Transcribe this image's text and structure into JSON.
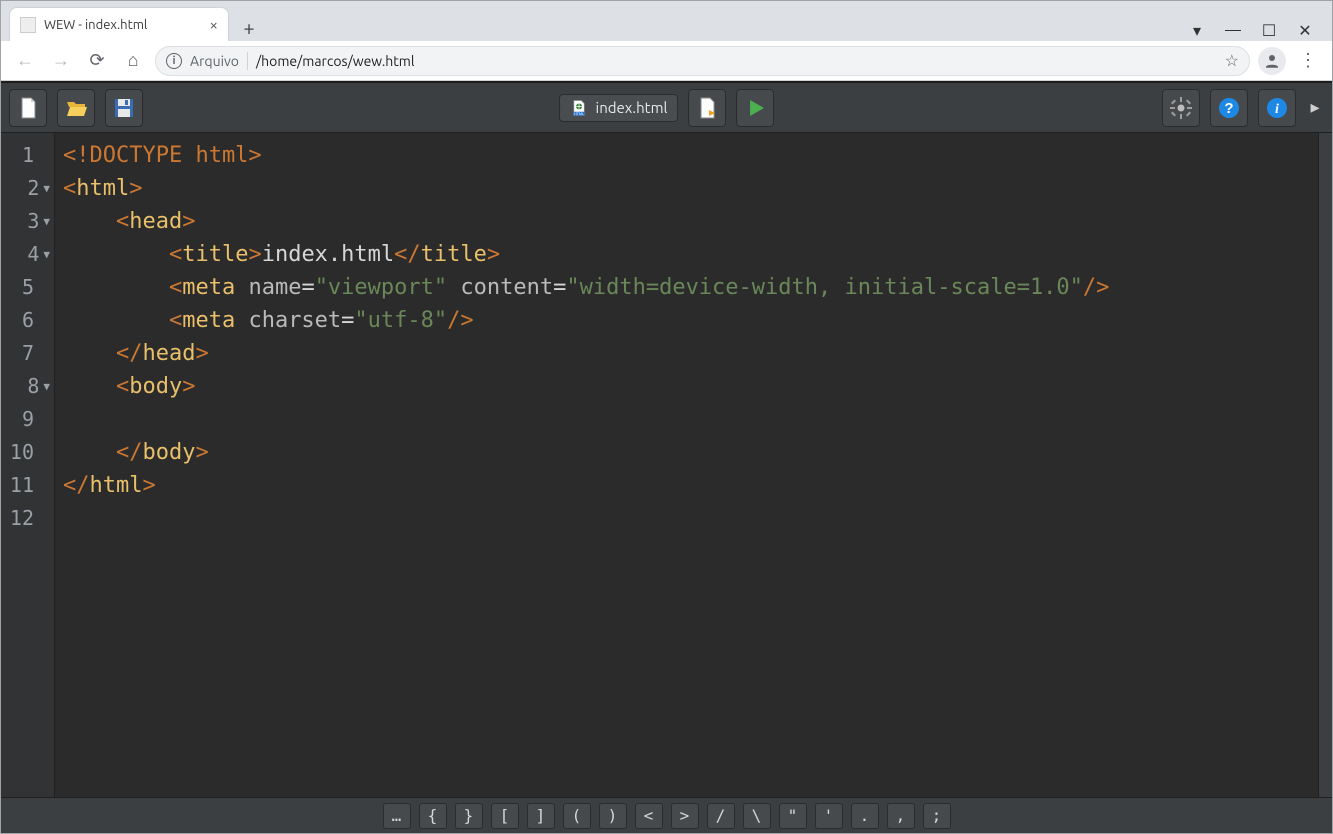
{
  "window": {
    "tab_title": "WEW - index.html",
    "minimize_glyph": "—",
    "maximize_glyph": "☐",
    "close_glyph": "✕"
  },
  "browser": {
    "tab_close_glyph": "×",
    "newtab_glyph": "+",
    "arrow_down_glyph": "▾",
    "info_glyph": "i",
    "file_label": "Arquivo",
    "path": "/home/marcos/wew.html",
    "star_glyph": "☆",
    "kebab_glyph": "⋮"
  },
  "editor": {
    "file_tab_label": "index.html",
    "more_glyph": "▸",
    "gutter": {
      "lines": [
        "1",
        "2",
        "3",
        "4",
        "5",
        "6",
        "7",
        "8",
        "9",
        "10",
        "11",
        "12"
      ],
      "fold_rows": [
        2,
        3,
        4,
        8
      ]
    },
    "code_lines": [
      {
        "indent": 0,
        "type": "decl",
        "text": "<!DOCTYPE html>"
      },
      {
        "indent": 0,
        "type": "open",
        "tag": "html"
      },
      {
        "indent": 1,
        "type": "open",
        "tag": "head"
      },
      {
        "indent": 2,
        "type": "wrap",
        "tag": "title",
        "content": "index.html"
      },
      {
        "indent": 2,
        "type": "self",
        "tag": "meta",
        "attrs": [
          {
            "n": "name",
            "v": "viewport"
          },
          {
            "n": "content",
            "v": "width=device-width, initial-scale=1.0"
          }
        ]
      },
      {
        "indent": 2,
        "type": "self",
        "tag": "meta",
        "attrs": [
          {
            "n": "charset",
            "v": "utf-8"
          }
        ]
      },
      {
        "indent": 1,
        "type": "close",
        "tag": "head"
      },
      {
        "indent": 1,
        "type": "open",
        "tag": "body"
      },
      {
        "indent": 0,
        "type": "blank"
      },
      {
        "indent": 1,
        "type": "close",
        "tag": "body"
      },
      {
        "indent": 0,
        "type": "close",
        "tag": "html"
      },
      {
        "indent": 0,
        "type": "blank"
      }
    ],
    "symbol_bar": [
      "…",
      "{",
      "}",
      "[",
      "]",
      "(",
      ")",
      "<",
      ">",
      "/",
      "\\",
      "\"",
      "'",
      ".",
      ",",
      ";"
    ]
  }
}
